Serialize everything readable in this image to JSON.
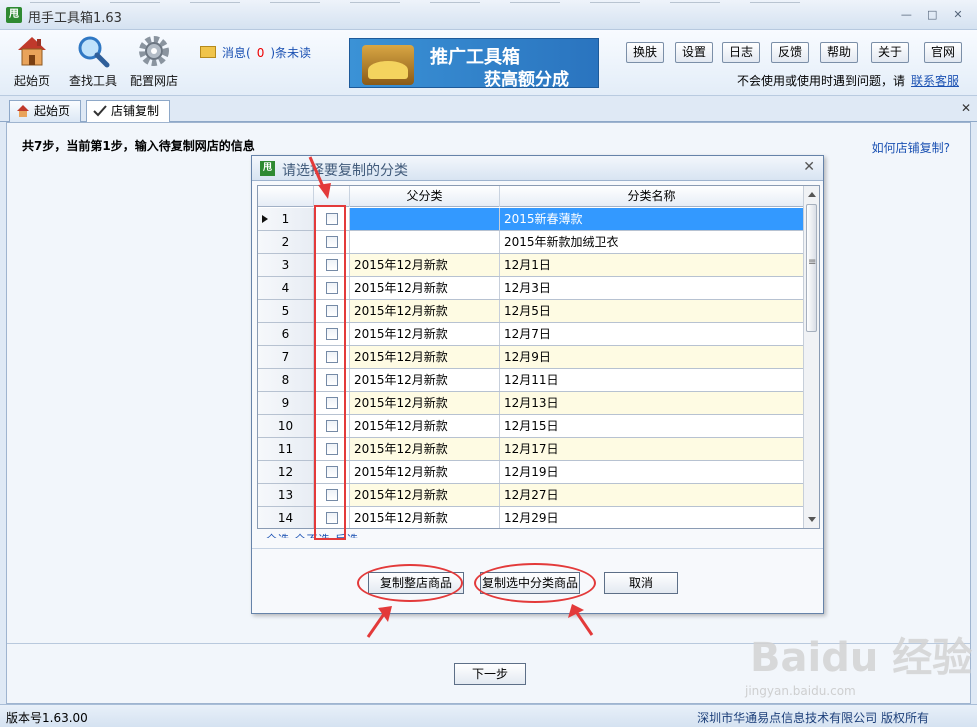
{
  "app": {
    "title": "甩手工具箱1.63",
    "logo_text": "甩"
  },
  "toolbar": {
    "home_label": "起始页",
    "find_label": "查找工具",
    "config_label": "配置网店",
    "msg_prefix": "消息(",
    "msg_count": "0",
    "msg_suffix": ")条未读",
    "banner_line1": "推广工具箱",
    "banner_line2": "获高额分成",
    "buttons": [
      {
        "label": "换肤"
      },
      {
        "label": "设置"
      },
      {
        "label": "日志"
      },
      {
        "label": "反馈"
      },
      {
        "label": "帮助"
      },
      {
        "label": "关于"
      },
      {
        "label": "官网"
      }
    ],
    "help_text": "不会使用或使用时遇到问题，请",
    "help_link": "联系客服"
  },
  "tabs": [
    {
      "label": "起始页"
    },
    {
      "label": "店铺复制"
    }
  ],
  "main": {
    "step_text": "共7步，当前第1步，输入待复制网店的信息",
    "howto_link": "如何店铺复制?",
    "next_button": "下一步"
  },
  "dialog": {
    "title": "请选择要复制的分类",
    "columns": {
      "parent": "父分类",
      "name": "分类名称"
    },
    "rows": [
      {
        "num": "1",
        "parent": "",
        "name": "2015新春薄款",
        "selected": true
      },
      {
        "num": "2",
        "parent": "",
        "name": "2015年新款加绒卫衣"
      },
      {
        "num": "3",
        "parent": "2015年12月新款",
        "name": "12月1日"
      },
      {
        "num": "4",
        "parent": "2015年12月新款",
        "name": "12月3日"
      },
      {
        "num": "5",
        "parent": "2015年12月新款",
        "name": "12月5日"
      },
      {
        "num": "6",
        "parent": "2015年12月新款",
        "name": "12月7日"
      },
      {
        "num": "7",
        "parent": "2015年12月新款",
        "name": "12月9日"
      },
      {
        "num": "8",
        "parent": "2015年12月新款",
        "name": "12月11日"
      },
      {
        "num": "9",
        "parent": "2015年12月新款",
        "name": "12月13日"
      },
      {
        "num": "10",
        "parent": "2015年12月新款",
        "name": "12月15日"
      },
      {
        "num": "11",
        "parent": "2015年12月新款",
        "name": "12月17日"
      },
      {
        "num": "12",
        "parent": "2015年12月新款",
        "name": "12月19日"
      },
      {
        "num": "13",
        "parent": "2015年12月新款",
        "name": "12月27日"
      },
      {
        "num": "14",
        "parent": "2015年12月新款",
        "name": "12月29日"
      }
    ],
    "footer_links": "全选   全不选   反选",
    "btn_copy_all": "复制整店商品",
    "btn_copy_selected": "复制选中分类商品",
    "btn_cancel": "取消"
  },
  "status": {
    "version": "版本号1.63.00",
    "copyright": "深圳市华通易点信息技术有限公司 版权所有"
  },
  "watermark": {
    "brand": "Baidu 经验",
    "url": "jingyan.baidu.com"
  },
  "colors": {
    "selected_row": "#3399ff",
    "odd_row": "#fefbe3",
    "annotation": "#e33a3a",
    "link": "#1c52b3"
  }
}
